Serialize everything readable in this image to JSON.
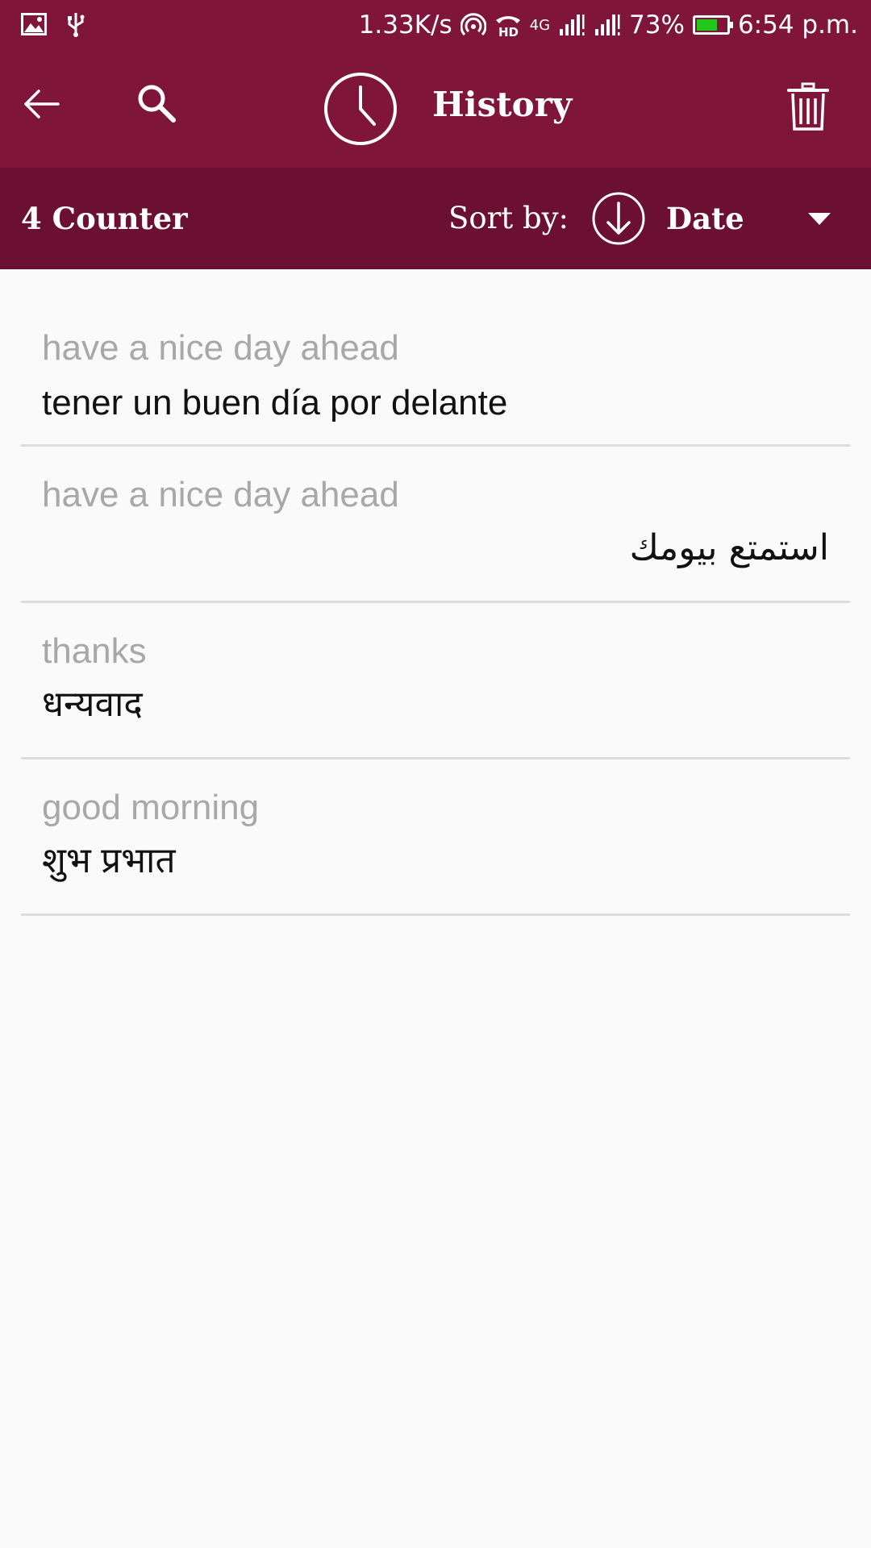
{
  "status_bar": {
    "speed": "1.33K/s",
    "network": "4G",
    "battery_percent": "73%",
    "battery_level": 0.73,
    "time": "6:54 p.m."
  },
  "app_bar": {
    "title": "History"
  },
  "sort_bar": {
    "counter": "4 Counter",
    "sort_label": "Sort by:",
    "sort_value": "Date"
  },
  "history": [
    {
      "source": "have a nice day ahead",
      "translation": "tener un buen día por delante",
      "rtl": false
    },
    {
      "source": "have a nice day ahead",
      "translation": "استمتع بيومك",
      "rtl": true
    },
    {
      "source": "thanks",
      "translation": "धन्यवाद",
      "rtl": false
    },
    {
      "source": "good morning",
      "translation": "शुभ प्रभात",
      "rtl": false
    }
  ],
  "colors": {
    "app_bar": "#7f1639",
    "sort_bar": "#6b1030",
    "background": "#fafafa",
    "battery": "#22c51a"
  }
}
